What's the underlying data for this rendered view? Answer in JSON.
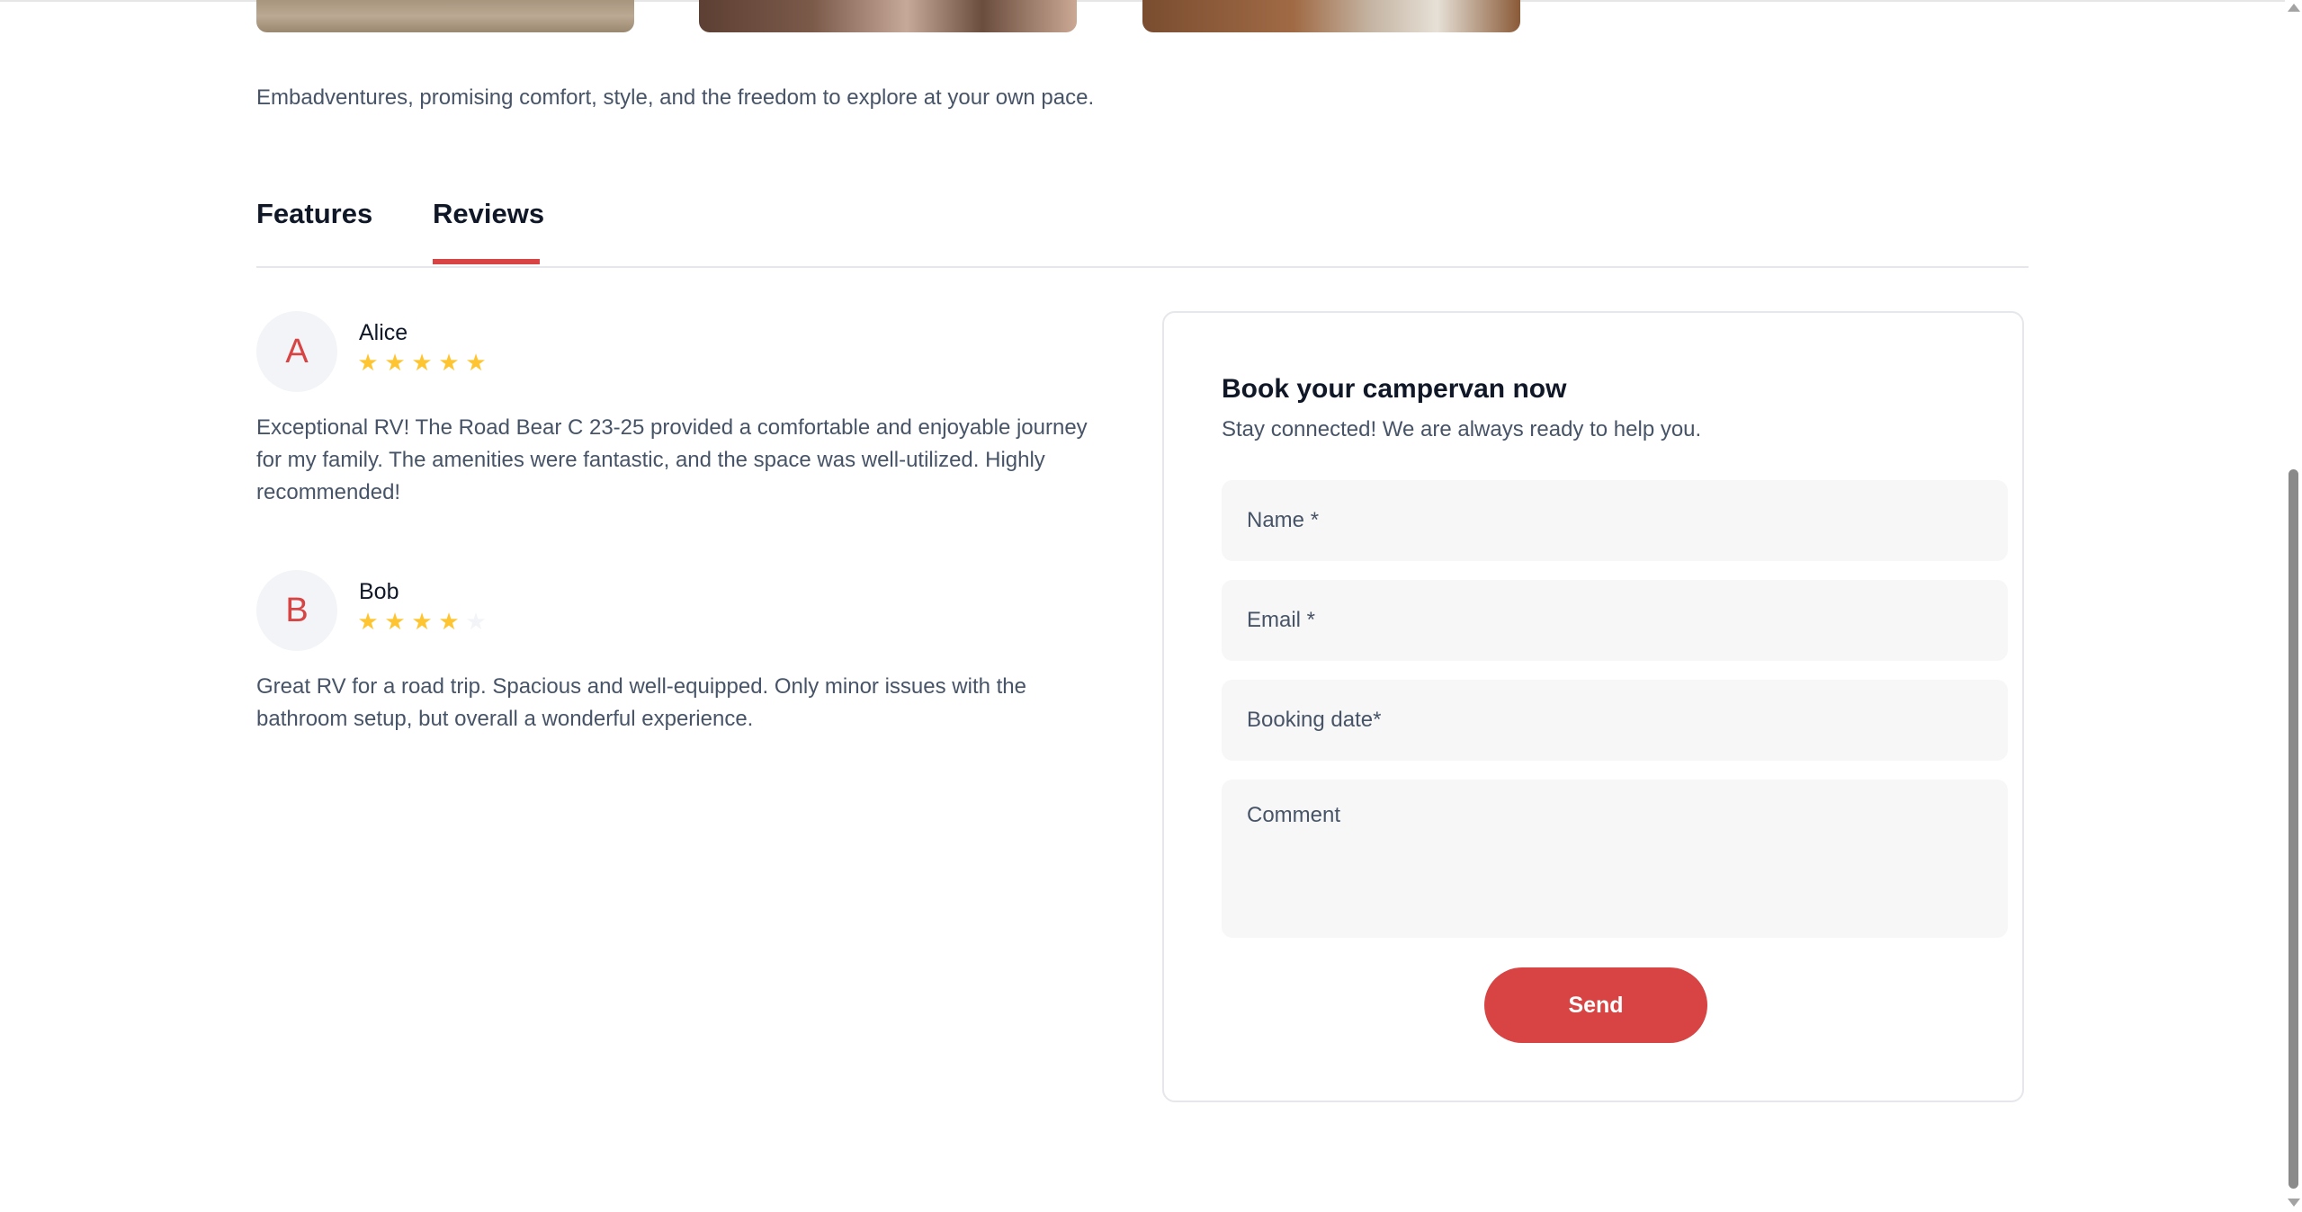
{
  "intro_text": "Embadventures, promising comfort, style, and the freedom to explore at your own pace.",
  "tabs": [
    {
      "label": "Features"
    },
    {
      "label": "Reviews"
    }
  ],
  "active_tab": "Reviews",
  "reviews": [
    {
      "initial": "A",
      "name": "Alice",
      "rating": 5,
      "text": "Exceptional RV! The Road Bear C 23-25 provided a comfortable and enjoyable journey for my family. The amenities were fantastic, and the space was well-utilized. Highly recommended!"
    },
    {
      "initial": "B",
      "name": "Bob",
      "rating": 4,
      "text": "Great RV for a road trip. Spacious and well-equipped. Only minor issues with the bathroom setup, but overall a wonderful experience."
    }
  ],
  "booking": {
    "title": "Book your campervan now",
    "subtitle": "Stay connected! We are always ready to help you.",
    "name_placeholder": "Name *",
    "email_placeholder": "Email *",
    "date_placeholder": "Booking date*",
    "comment_placeholder": "Comment",
    "send_label": "Send"
  },
  "colors": {
    "accent": "#d84343",
    "star": "#ffc531",
    "star_empty": "#f2f4f7",
    "text_muted": "#475467",
    "field_bg": "#f7f7f7"
  },
  "icons": {
    "star": "star-icon",
    "scroll_up": "scroll-up-arrow-icon",
    "scroll_down": "scroll-down-arrow-icon"
  }
}
